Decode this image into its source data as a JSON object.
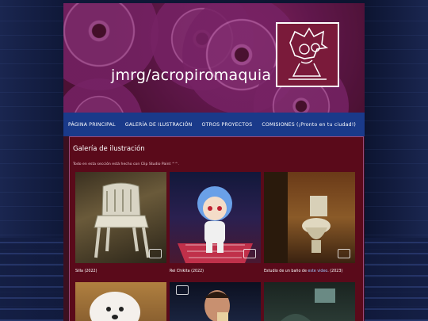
{
  "site": {
    "title": "jmrg/acropiromaquia"
  },
  "nav": {
    "items": [
      "PÁGINA PRINCIPAL",
      "GALERÍA DE ILUSTRACIÓN",
      "OTROS PROYECTOS",
      "COMISIONES (¡Pronto en tu ciudad!)"
    ]
  },
  "gallery": {
    "title": "Galería de ilustración",
    "description": "Todo en esta sección está hecho con Clip Studio Paint ^^.",
    "items": [
      {
        "caption": "Silla (2022)"
      },
      {
        "caption": "Rei Chikita (2022)"
      },
      {
        "caption_prefix": "Estudio de un baño de ",
        "caption_link": "este video",
        "caption_suffix": ". (2023)"
      }
    ]
  },
  "colors": {
    "nav_bg": "#1a3a8a",
    "content_bg": "#5a0a1a",
    "link": "#9ec8ff"
  }
}
